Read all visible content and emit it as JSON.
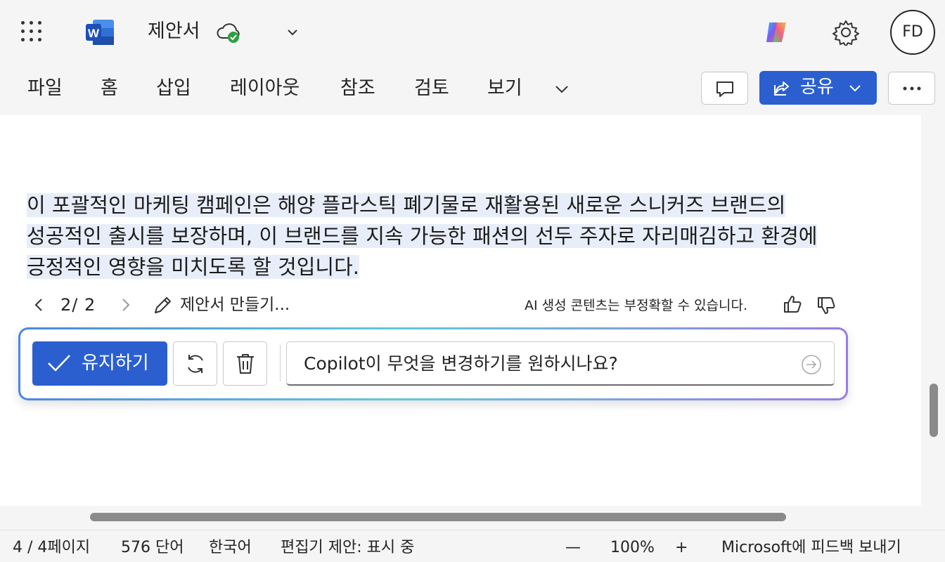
{
  "app": {
    "name": "Word",
    "document_title": "제안서",
    "user_initials": "FD"
  },
  "ribbon": {
    "tabs": [
      "파일",
      "홈",
      "삽입",
      "레이아웃",
      "참조",
      "검토",
      "보기"
    ],
    "share_label": "공유"
  },
  "document": {
    "paragraph_lines": [
      "이 포괄적인 마케팅 캠페인은 해양 플라스틱 폐기물로 재활용된 새로운 스니커즈 브랜드의",
      "성공적인 출시를 보장하며, 이 브랜드를 지속 가능한 패션의 선두 주자로 자리매김하고 환경에",
      "긍정적인 영향을 미치도록 할 것입니다."
    ]
  },
  "copilot": {
    "page_counter": "2/ 2",
    "draft_label": "제안서 만들기...",
    "disclaimer": "AI 생성 콘텐츠는 부정확할 수 있습니다.",
    "keep_label": "유지하기",
    "prompt_placeholder": "Copilot이 무엇을 변경하기를 원하시나요?"
  },
  "status": {
    "page": "4 / 4페이지",
    "words": "576 단어",
    "language": "한국어",
    "editor": "편집기 제안: 표시 중",
    "zoom_out": "—",
    "zoom": "100%",
    "zoom_in": "+",
    "feedback": "Microsoft에 피드백 보내기"
  },
  "colors": {
    "accent": "#2b5fd0",
    "selection": "#e8eef9",
    "chrome": "#f5f5f5"
  }
}
